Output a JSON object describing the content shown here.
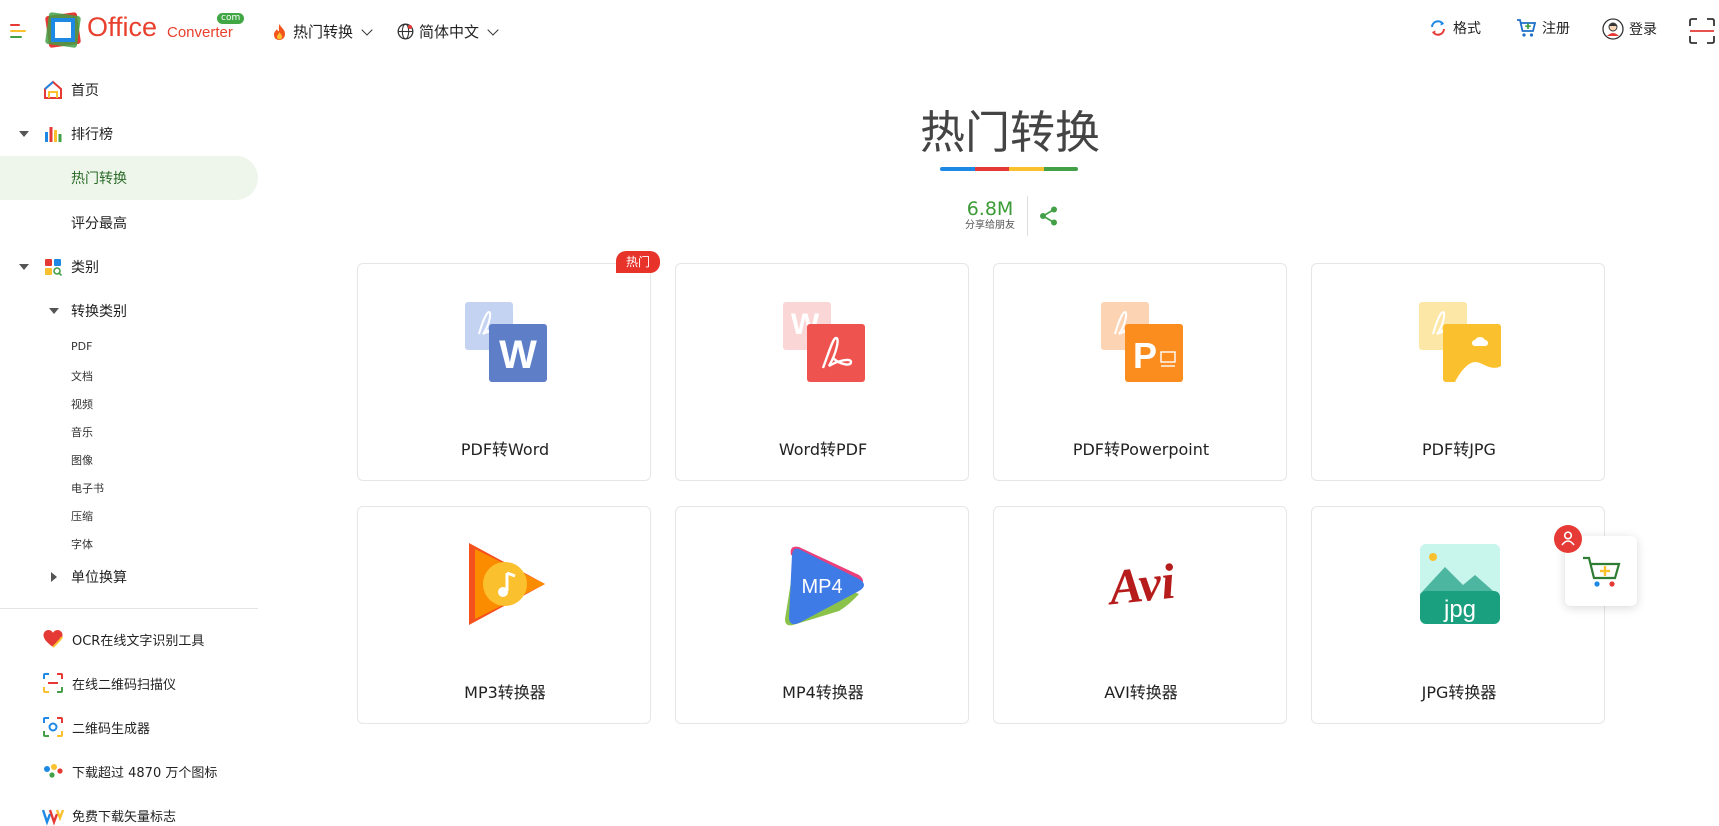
{
  "header": {
    "logo": {
      "office": "Office",
      "converter": "Converter",
      "com": "com"
    },
    "nav": [
      {
        "label": "热门转换",
        "icon": "fire-icon"
      },
      {
        "label": "简体中文",
        "icon": "globe-icon"
      }
    ],
    "actions": [
      {
        "label": "格式",
        "icon": "refresh-formats-icon"
      },
      {
        "label": "注册",
        "icon": "cart-icon"
      },
      {
        "label": "登录",
        "icon": "user-avatar-icon"
      }
    ]
  },
  "sidebar": {
    "items": [
      {
        "label": "首页",
        "icon": "home-icon"
      },
      {
        "label": "排行榜",
        "icon": "bar-chart-icon"
      },
      {
        "label": "热门转换",
        "active": true
      },
      {
        "label": "评分最高"
      },
      {
        "label": "类别",
        "icon": "categories-icon"
      },
      {
        "label": "转换类别"
      }
    ],
    "sub_items": [
      "PDF",
      "文档",
      "视频",
      "音乐",
      "图像",
      "电子书",
      "压缩",
      "字体"
    ],
    "unit": "单位换算",
    "tools": [
      {
        "label": "OCR在线文字识别工具",
        "icon": "heart-icon"
      },
      {
        "label": "在线二维码扫描仪",
        "icon": "scanner-icon"
      },
      {
        "label": "二维码生成器",
        "icon": "qr-generator-icon"
      },
      {
        "label": "下载超过 4870 万个图标",
        "icon": "dots-icon"
      },
      {
        "label": "免费下载矢量标志",
        "icon": "vector-logo-icon"
      }
    ]
  },
  "main": {
    "title": "热门转换",
    "title_bar_colors": [
      "#1e88e5",
      "#e53935",
      "#fbc02d",
      "#43a047"
    ],
    "stats": {
      "value": "6.8M",
      "label": "分享给朋友"
    },
    "hot_badge": "热门",
    "cards": [
      {
        "label": "PDF转Word",
        "icon": "pdf-to-word-icon"
      },
      {
        "label": "Word转PDF",
        "icon": "word-to-pdf-icon"
      },
      {
        "label": "PDF转Powerpoint",
        "icon": "pdf-to-powerpoint-icon"
      },
      {
        "label": "PDF转JPG",
        "icon": "pdf-to-jpg-icon"
      },
      {
        "label": "MP3转换器",
        "icon": "mp3-icon"
      },
      {
        "label": "MP4转换器",
        "icon": "mp4-icon",
        "icon_text": "MP4"
      },
      {
        "label": "AVI转换器",
        "icon": "avi-icon",
        "icon_text": "Avi"
      },
      {
        "label": "JPG转换器",
        "icon": "jpg-icon",
        "icon_text": "jpg"
      }
    ]
  }
}
